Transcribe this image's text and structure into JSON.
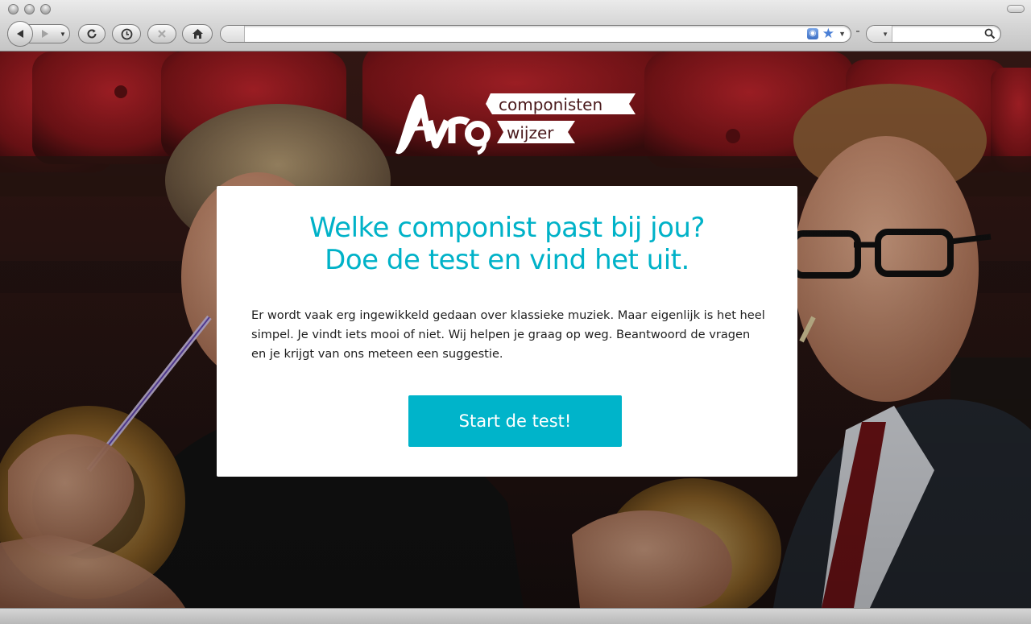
{
  "browser": {
    "url_value": "",
    "search_value": "",
    "icons": {
      "back": "back-arrow-icon",
      "forward": "forward-arrow-icon",
      "history_menu": "chevron-down-icon",
      "reload": "reload-icon",
      "history": "clock-icon",
      "stop": "close-icon",
      "home": "home-icon",
      "rss": "rss-icon",
      "bookmark": "star-icon",
      "search": "magnifier-icon"
    }
  },
  "logo": {
    "brand": "Avro",
    "line1": "componisten",
    "line2": "wijzer",
    "color": "#ffffff",
    "text_color": "#4a1a1c"
  },
  "card": {
    "title_line1": "Welke componist past bij jou?",
    "title_line2": "Doe de test en vind het uit.",
    "body": "Er wordt vaak erg ingewikkeld gedaan over klassieke muziek. Maar eigenlijk is het heel simpel. Je vindt iets mooi of niet. Wij helpen je graag op weg. Beantwoord de vragen en je krijgt van ons meteen een suggestie.",
    "button_label": "Start de test!"
  },
  "colors": {
    "accent": "#00b4ca",
    "title": "#00b2c8",
    "body_text": "#1e1e1e",
    "card_bg": "#ffffff"
  }
}
